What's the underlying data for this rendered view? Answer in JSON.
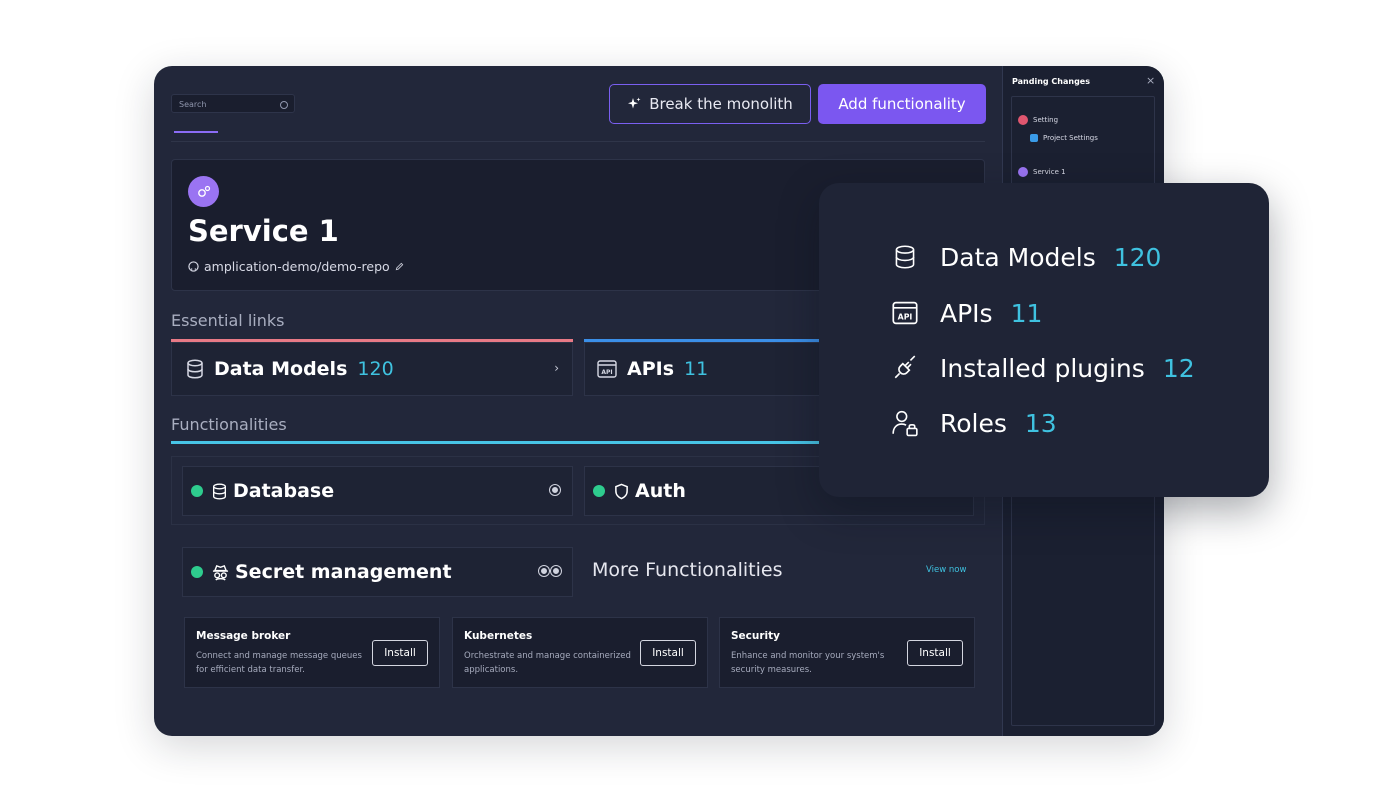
{
  "search": {
    "placeholder": "Search"
  },
  "toolbar": {
    "break_label": "Break the monolith",
    "add_label": "Add functionality"
  },
  "service": {
    "title": "Service 1",
    "repo": "amplication-demo/demo-repo"
  },
  "essential": {
    "label": "Essential links",
    "data_models": {
      "label": "Data Models",
      "count": "120"
    },
    "apis": {
      "label": "APIs",
      "count": "11"
    }
  },
  "functionalities": {
    "label": "Functionalities",
    "items": [
      {
        "label": "Database"
      },
      {
        "label": "Auth"
      },
      {
        "label": "Secret management"
      }
    ],
    "more_title": "More Functionalities",
    "view_now": "View now"
  },
  "install_cards": [
    {
      "title": "Message broker",
      "desc": "Connect and manage message queues for efficient data transfer.",
      "button": "Install"
    },
    {
      "title": "Kubernetes",
      "desc": "Orchestrate and manage containerized applications.",
      "button": "Install"
    },
    {
      "title": "Security",
      "desc": "Enhance and monitor your system's security measures.",
      "button": "Install"
    }
  ],
  "pending": {
    "title": "Panding Changes",
    "close": "×",
    "items": [
      {
        "label": "Setting",
        "color": "#e0566f"
      },
      {
        "label": "Project Settings",
        "color": "#3a9be8"
      },
      {
        "label": "Service 1",
        "color": "#9a74f2"
      }
    ]
  },
  "popup": {
    "items": [
      {
        "label": "Data Models",
        "count": "120",
        "icon": "database-icon"
      },
      {
        "label": "APIs",
        "count": "11",
        "icon": "api-icon"
      },
      {
        "label": "Installed plugins",
        "count": "12",
        "icon": "plug-icon"
      },
      {
        "label": "Roles",
        "count": "13",
        "icon": "user-lock-icon"
      }
    ]
  },
  "colors": {
    "accent": "#7b57f0",
    "count": "#3fc2e0",
    "status_on": "#2ecc8e",
    "data_models_bar": "#e87a86",
    "apis_bar": "#3b8fe8"
  }
}
